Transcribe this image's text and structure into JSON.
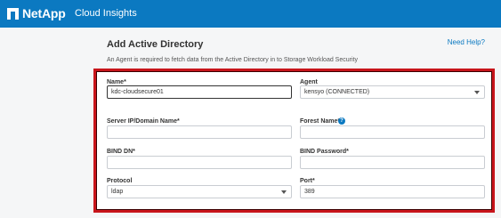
{
  "header": {
    "brand": "NetApp",
    "product": "Cloud Insights"
  },
  "page": {
    "title": "Add Active Directory",
    "help_link": "Need Help?",
    "subtitle": "An Agent is required to fetch data from the Active Directory in to Storage Workload Security"
  },
  "form": {
    "name": {
      "label": "Name*",
      "value": "kdc-cloudsecure01"
    },
    "agent": {
      "label": "Agent",
      "value": "kensyo (CONNECTED)"
    },
    "server": {
      "label": "Server IP/Domain Name*",
      "value": ""
    },
    "forest": {
      "label": "Forest Name*",
      "value": ""
    },
    "bind_dn": {
      "label": "BIND DN*",
      "value": ""
    },
    "bind_password": {
      "label": "BIND Password*",
      "value": ""
    },
    "protocol": {
      "label": "Protocol",
      "value": "ldap"
    },
    "port": {
      "label": "Port*",
      "value": "389"
    }
  },
  "colors": {
    "topbar": "#0b79c1",
    "highlight_border": "#c8151b"
  }
}
